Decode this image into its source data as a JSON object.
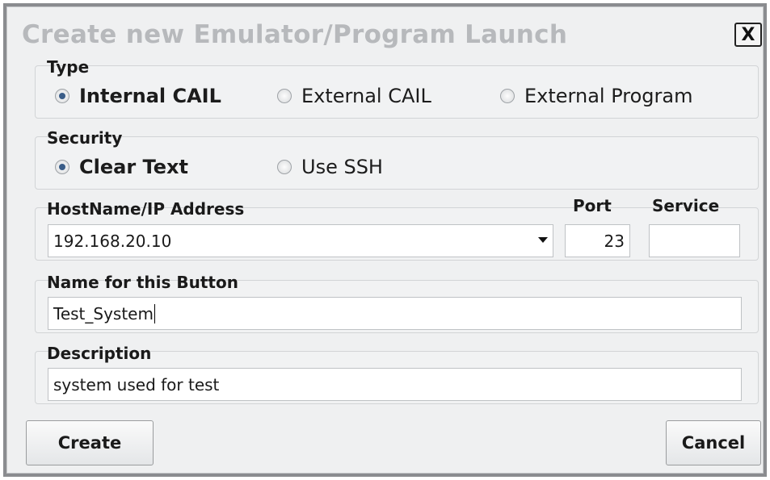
{
  "dialog": {
    "title": "Create new Emulator/Program Launch",
    "close_label": "X"
  },
  "type_group": {
    "label": "Type",
    "options": [
      {
        "label": "Internal CAIL",
        "selected": true
      },
      {
        "label": "External CAIL",
        "selected": false
      },
      {
        "label": "External Program",
        "selected": false
      }
    ]
  },
  "security_group": {
    "label": "Security",
    "options": [
      {
        "label": "Clear Text",
        "selected": true
      },
      {
        "label": "Use SSH",
        "selected": false
      }
    ]
  },
  "host_group": {
    "host_label": "HostName/IP Address",
    "host_value": "192.168.20.10",
    "port_label": "Port",
    "port_value": "23",
    "service_label": "Service",
    "service_value": ""
  },
  "name_group": {
    "label": "Name for this Button",
    "value": "Test_System"
  },
  "description_group": {
    "label": "Description",
    "value": "system used for test"
  },
  "buttons": {
    "create_label": "Create",
    "cancel_label": "Cancel"
  }
}
